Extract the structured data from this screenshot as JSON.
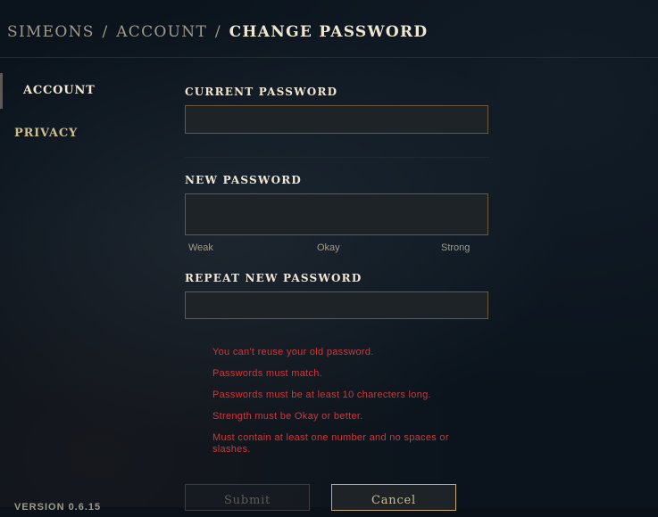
{
  "breadcrumb": {
    "part1": "SIMEONS",
    "sep1": "/",
    "part2": "ACCOUNT",
    "sep2": "/",
    "current": "CHANGE PASSWORD"
  },
  "sidebar": {
    "items": [
      {
        "label": "ACCOUNT",
        "active": true
      },
      {
        "label": "PRIVACY",
        "active": false
      }
    ],
    "version": "VERSION 0.6.15"
  },
  "form": {
    "current_password": {
      "label": "CURRENT PASSWORD",
      "value": ""
    },
    "new_password": {
      "label": "NEW PASSWORD",
      "value": ""
    },
    "strength": {
      "weak": "Weak",
      "okay": "Okay",
      "strong": "Strong"
    },
    "repeat_password": {
      "label": "REPEAT NEW PASSWORD",
      "value": ""
    },
    "errors": [
      "You can't reuse your old password.",
      "Passwords must match.",
      "Passwords must be at least 10 charecters long.",
      "Strength must be Okay or better.",
      "Must contain at least one number and no spaces or slashes."
    ],
    "submit_label": "Submit",
    "cancel_label": "Cancel"
  },
  "colors": {
    "accent_gold": "#c8aa6e",
    "error_red": "#d13639",
    "text_light": "#f0e6d2"
  }
}
